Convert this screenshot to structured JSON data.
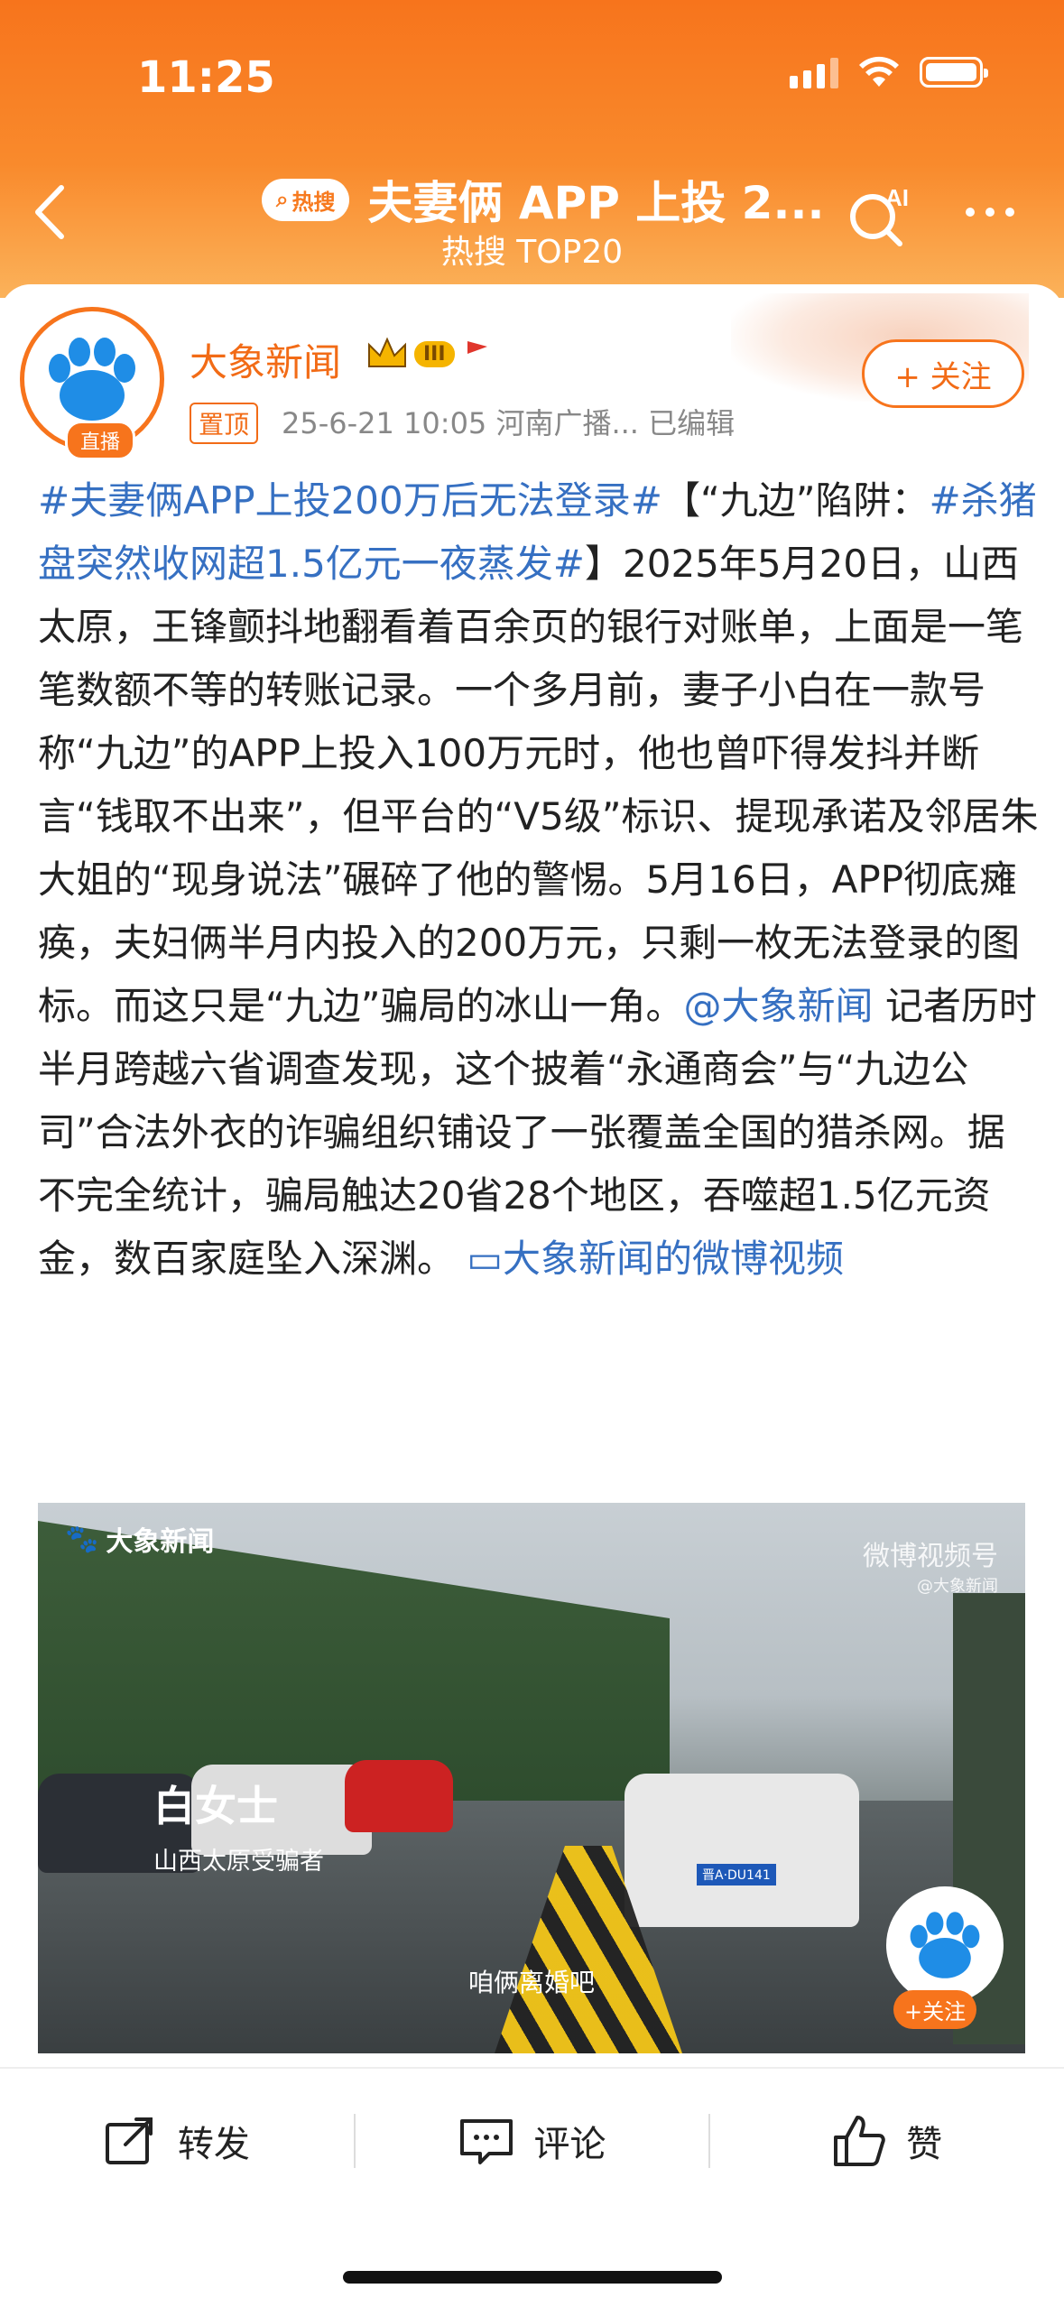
{
  "status_bar": {
    "time": "11:25"
  },
  "nav": {
    "hot_label": "热搜",
    "title": "夫妻俩 APP 上投 2...",
    "subtitle": "热搜 TOP20"
  },
  "post": {
    "author": "大象新闻",
    "level_badge": "III",
    "live_label": "直播",
    "pinned_label": "置顶",
    "meta": "25-6-21 10:05  河南广播...  已编辑",
    "follow_label": "+ 关注",
    "tag1": "#夫妻俩APP上投200万后无法登录#",
    "text1": "【“九边”陷阱：",
    "tag2": "#杀猪盘突然收网超1.5亿元一夜蒸发#",
    "text2": "】2025年5月20日，山西太原，王锋颤抖地翻看着百余页的银行对账单，上面是一笔笔数额不等的转账记录。一个多月前，妻子小白在一款号称“九边”的APP上投入100万元时，他也曾吓得发抖并断言“钱取不出来”，但平台的“V5级”标识、提现承诺及邻居朱大姐的“现身说法”碾碎了他的警惕。5月16日，APP彻底瘫痪，夫妇俩半月内投入的200万元，只剩一枚无法登录的图标。而这只是“九边”骗局的冰山一角。",
    "mention": "@大象新闻",
    "text3": " 记者历时半月跨越六省调查发现，这个披着“永通商会”与“九边公司”合法外衣的诈骗组织铺设了一张覆盖全国的猎杀网。据不完全统计，骗局触达20省28个地区，吞噬超1.5亿元资金，数百家庭坠入深渊。 ",
    "video_link": "大象新闻的微博视频"
  },
  "video": {
    "logo_text": "大象新闻",
    "watermark": "微博视频号",
    "watermark_sub": "@大象新闻",
    "speaker_name": "白女士",
    "speaker_desc": "山西太原受骗者",
    "subtitle": "咱俩离婚吧",
    "follow_label": "+关注",
    "plate": "晋A·DU141"
  },
  "actions": {
    "share": "转发",
    "comment": "评论",
    "like": "赞"
  },
  "colors": {
    "accent": "#f7741c",
    "link": "#3670c2"
  }
}
